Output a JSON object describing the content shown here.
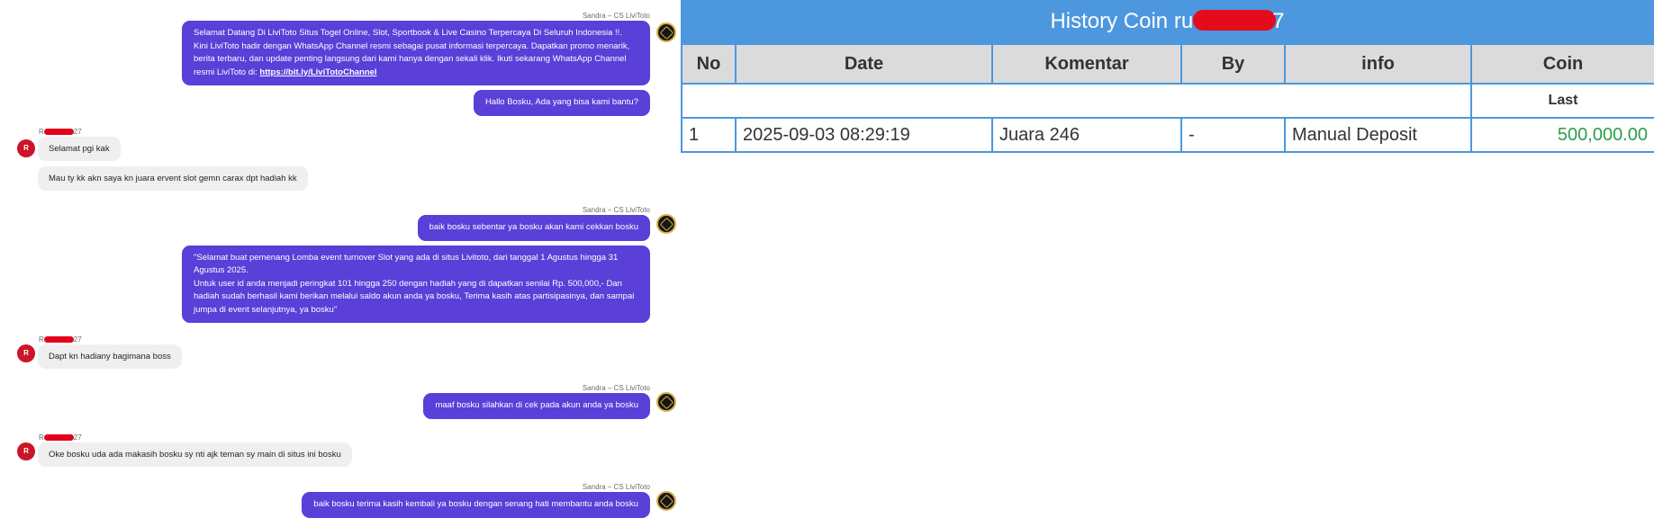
{
  "chat": {
    "agent_name": "Sandra – CS LiviToto",
    "user_initial": "R",
    "user_name_prefix": "R",
    "user_name_suffix": "27",
    "messages": [
      {
        "from": "agent",
        "lines": [
          "Selamat Datang Di LiviToto Situs Togel Online, Slot, Sportbook & Live Casino Terpercaya Di Seluruh Indonesia !!.",
          "Kini LiviToto hadir dengan WhatsApp Channel resmi sebagai pusat informasi terpercaya. Dapatkan promo menarik,",
          "berita terbaru, dan update penting langsung dari kami hanya dengan sekali klik. Ikuti sekarang WhatsApp Channel"
        ],
        "last_line_text": "resmi LiviToto di: ",
        "link": "https://bit.ly/LiviTotoChannel"
      },
      {
        "from": "agent",
        "text": "Hallo Bosku, Ada yang bisa kami bantu?"
      },
      {
        "from": "user",
        "text": "Selamat pgi kak"
      },
      {
        "from": "user",
        "text": "Mau ty kk akn saya kn juara ervent slot gemn carax dpt hadiah kk"
      },
      {
        "from": "agent",
        "text": "baik bosku sebentar ya bosku akan kami cekkan bosku"
      },
      {
        "from": "agent",
        "lines": [
          "\"Selamat buat pemenang Lomba event turnover Slot yang ada di situs Livitoto, dari tanggal 1 Agustus hingga 31",
          "Agustus 2025.",
          "Untuk user id anda menjadi peringkat 101 hingga 250 dengan hadiah yang di dapatkan senilai Rp. 500,000,- Dan",
          "hadiah sudah berhasil kami berikan melalui saldo akun anda ya bosku, Terima kasih atas partisipasinya, dan sampai",
          "jumpa di event selanjutnya, ya bosku\""
        ]
      },
      {
        "from": "user",
        "text": "Dapt kn hadiany bagimana boss"
      },
      {
        "from": "agent",
        "text": "maaf bosku silahkan di cek pada akun anda ya bosku"
      },
      {
        "from": "user",
        "text": "Oke bosku uda ada makasih bosku sy nti ajk teman sy main di situs ini bosku"
      },
      {
        "from": "agent",
        "text": "baik bosku terima kasih kembali ya bosku dengan senang hati membantu anda bosku"
      }
    ]
  },
  "history": {
    "title_prefix": "History Coin ru",
    "title_suffix": "7",
    "columns": [
      "No",
      "Date",
      "Komentar",
      "By",
      "info",
      "Coin"
    ],
    "last_label": "Last",
    "rows": [
      {
        "no": "1",
        "date": "2025-09-03 08:29:19",
        "komentar": "Juara 246",
        "by": "-",
        "info": "Manual Deposit",
        "coin": "500,000.00"
      }
    ],
    "coin_color": "#2e9d4a",
    "accent_color": "#4d97de"
  }
}
